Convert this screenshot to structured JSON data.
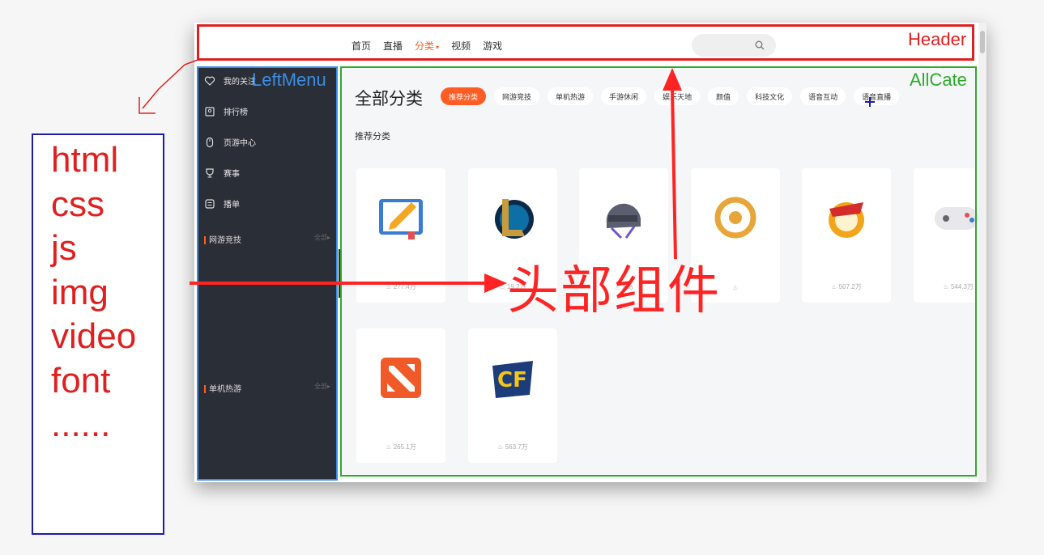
{
  "asset_list": [
    "html",
    "css",
    "js",
    "img",
    "video",
    "font",
    "......"
  ],
  "header": {
    "nav": [
      "首页",
      "直播",
      "分类",
      "视频",
      "游戏"
    ],
    "active_nav": "分类",
    "search_placeholder": ""
  },
  "left_menu": {
    "items": [
      "我的关注",
      "排行榜",
      "页游中心",
      "赛事",
      "播单"
    ],
    "sections": [
      {
        "label": "网游竞技",
        "all": "全部"
      },
      {
        "label": "单机热游",
        "all": "全部"
      }
    ]
  },
  "main": {
    "title": "全部分类",
    "tabs": [
      "推荐分类",
      "网游竞技",
      "单机热游",
      "手游休闲",
      "娱乐天地",
      "颜值",
      "科技文化",
      "语音互动",
      "语音直播"
    ],
    "active_tab": "推荐分类",
    "section_title": "推荐分类",
    "cards": [
      {
        "icon": "book-icon",
        "heat": "277.4万"
      },
      {
        "icon": "lol-icon",
        "heat": "19.2万"
      },
      {
        "icon": "helmet-icon",
        "heat": "246"
      },
      {
        "icon": "compass-icon",
        "heat": ""
      },
      {
        "icon": "dnf-icon",
        "heat": "507.2万"
      },
      {
        "icon": "gamepad-icon",
        "heat": "544.3万"
      },
      {
        "icon": "dota-icon",
        "heat": "265.1万"
      },
      {
        "icon": "cf-icon",
        "heat": "563.7万"
      }
    ]
  },
  "annotations": {
    "header": "Header",
    "leftmenu": "LeftMenu",
    "allcate": "AllCate",
    "big_text": "头部组件"
  },
  "colors": {
    "accent": "#ff5d23",
    "header_box": "#e02020",
    "leftmenu_box": "#3a8ee6",
    "allcate_box": "#2eaa2e",
    "arrow": "#ff2424"
  }
}
